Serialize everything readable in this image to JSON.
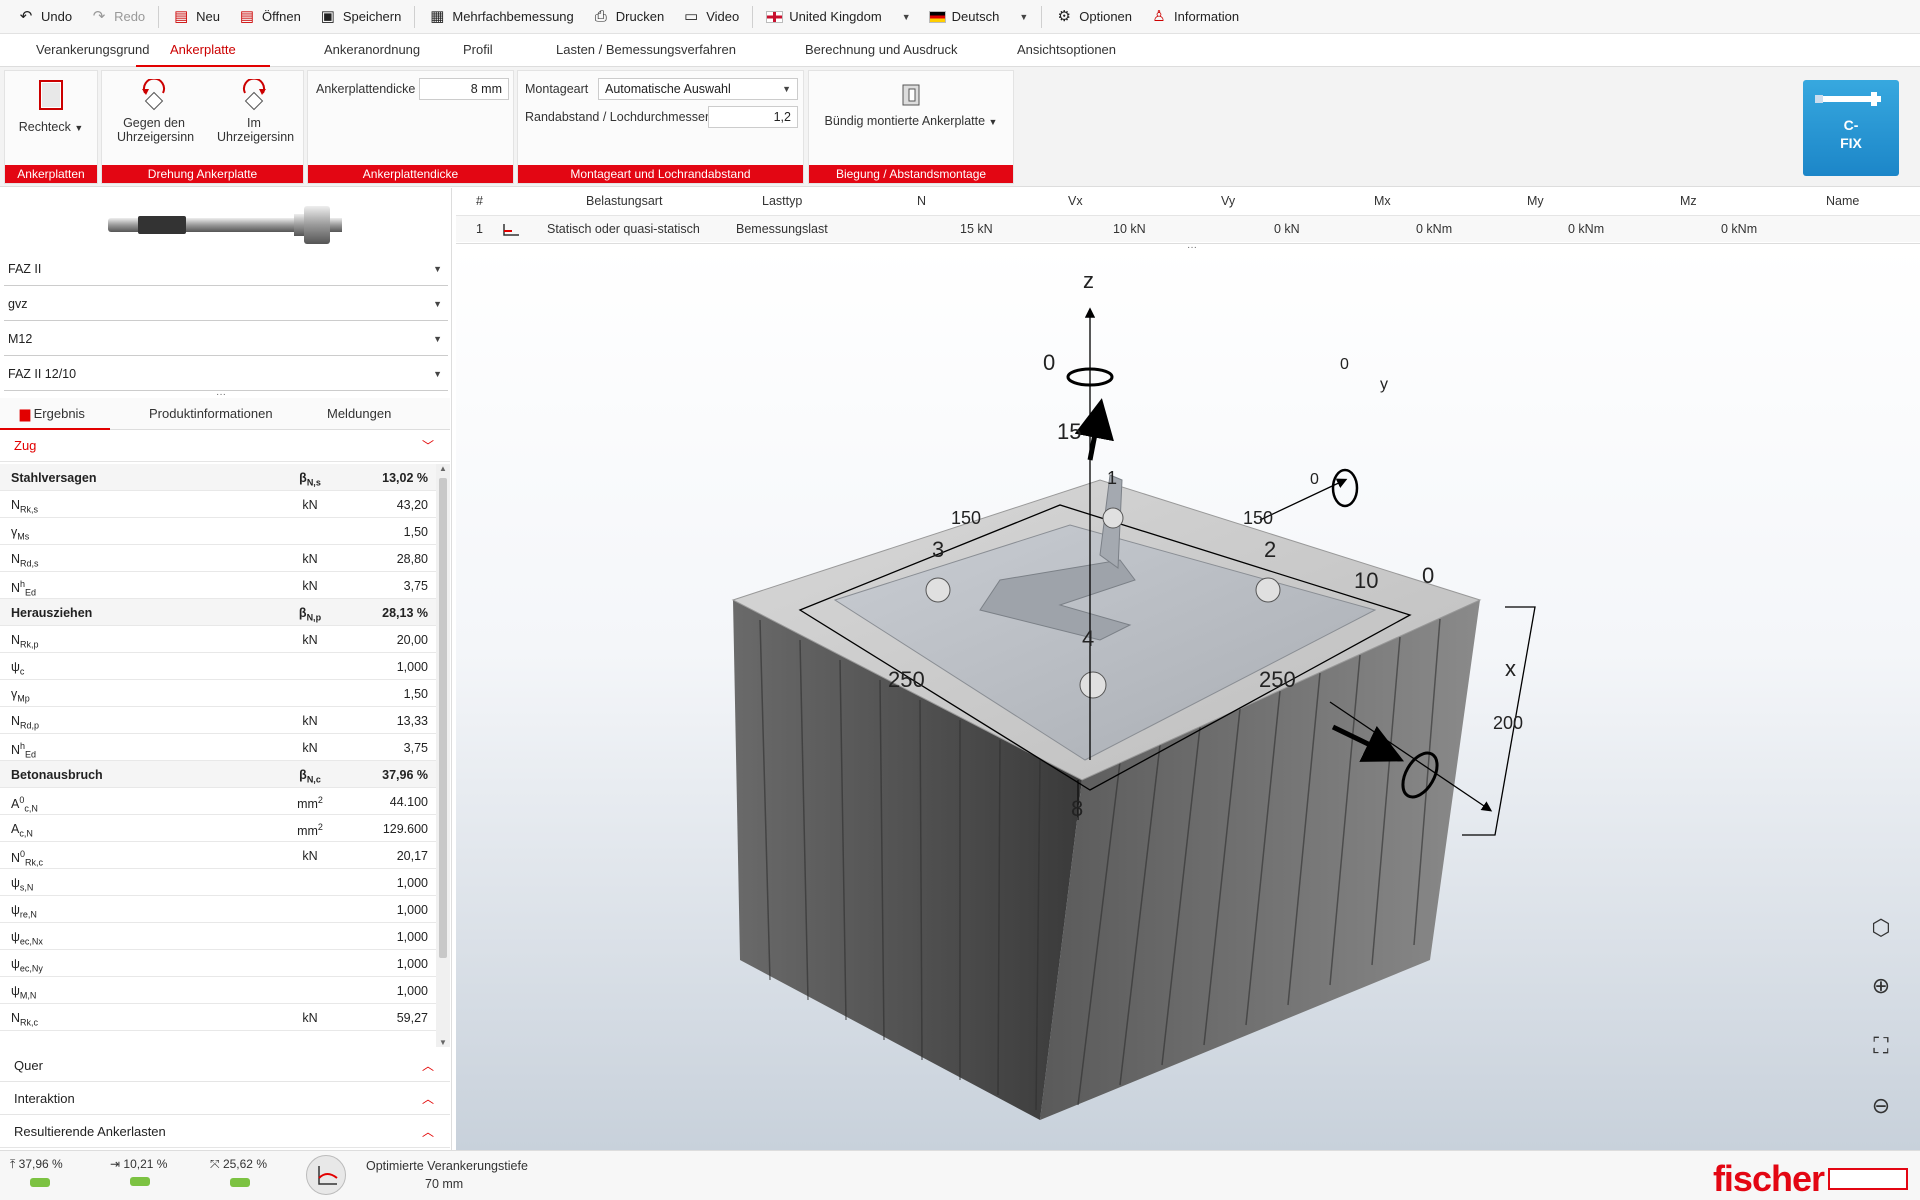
{
  "toolbar": {
    "undo": "Undo",
    "redo": "Redo",
    "new": "Neu",
    "open": "Öffnen",
    "save": "Speichern",
    "multi": "Mehrfachbemessung",
    "print": "Drucken",
    "video": "Video",
    "country": "United Kingdom",
    "language": "Deutsch",
    "options": "Optionen",
    "info": "Information"
  },
  "tabs": [
    "Verankerungsgrund",
    "Ankerplatte",
    "Ankeranordnung",
    "Profil",
    "Lasten / Bemessungsverfahren",
    "Berechnung und Ausdruck",
    "Ansichtsoptionen"
  ],
  "ribbon": {
    "shape": "Rechteck",
    "group_plates": "Ankerplatten",
    "ccw": "Gegen den Uhrzeigersinn",
    "cw": "Im Uhrzeigersinn",
    "group_rotation": "Drehung Ankerplatte",
    "thickness_label": "Ankerplattendicke",
    "thickness_value": "8 mm",
    "group_thickness": "Ankerplattendicke",
    "mount_label": "Montageart",
    "mount_value": "Automatische Auswahl",
    "edge_label": "Randabstand / Lochdurchmesser",
    "edge_value": "1,2",
    "group_mount": "Montageart und Lochrandabstand",
    "flush": "Bündig montierte Ankerplatte",
    "group_bend": "Biegung / Abstandsmontage",
    "cfix_line1": "C-",
    "cfix_line2": "FIX"
  },
  "product": {
    "selects": [
      "FAZ II",
      "gvz",
      "M12",
      "FAZ II 12/10"
    ]
  },
  "result_tabs": [
    "Ergebnis",
    "Produktinformationen",
    "Meldungen"
  ],
  "sections": {
    "zug": "Zug",
    "quer": "Quer",
    "interaktion": "Interaktion",
    "resultierende": "Resultierende Ankerlasten"
  },
  "rows": [
    {
      "k": "Stahlversagen",
      "u": "βN,s",
      "v": "13,02 %",
      "bold": true
    },
    {
      "k": "NRk,s",
      "u": "kN",
      "v": "43,20"
    },
    {
      "k": "γMs",
      "u": "",
      "v": "1,50"
    },
    {
      "k": "NRd,s",
      "u": "kN",
      "v": "28,80"
    },
    {
      "k": "NhEd",
      "u": "kN",
      "v": "3,75"
    },
    {
      "k": "Herausziehen",
      "u": "βN,p",
      "v": "28,13 %",
      "bold": true
    },
    {
      "k": "NRk,p",
      "u": "kN",
      "v": "20,00"
    },
    {
      "k": "ψc",
      "u": "",
      "v": "1,000"
    },
    {
      "k": "γMp",
      "u": "",
      "v": "1,50"
    },
    {
      "k": "NRd,p",
      "u": "kN",
      "v": "13,33"
    },
    {
      "k": "NhEd",
      "u": "kN",
      "v": "3,75"
    },
    {
      "k": "Betonausbruch",
      "u": "βN,c",
      "v": "37,96 %",
      "bold": true
    },
    {
      "k": "A0c,N",
      "u": "mm2",
      "v": "44.100"
    },
    {
      "k": "Ac,N",
      "u": "mm2",
      "v": "129.600"
    },
    {
      "k": "N0Rk,c",
      "u": "kN",
      "v": "20,17"
    },
    {
      "k": "ψs,N",
      "u": "",
      "v": "1,000"
    },
    {
      "k": "ψre,N",
      "u": "",
      "v": "1,000"
    },
    {
      "k": "ψec,Nx",
      "u": "",
      "v": "1,000"
    },
    {
      "k": "ψec,Ny",
      "u": "",
      "v": "1,000"
    },
    {
      "k": "ψM,N",
      "u": "",
      "v": "1,000"
    },
    {
      "k": "NRk,c",
      "u": "kN",
      "v": "59,27"
    }
  ],
  "loads": {
    "headers": [
      "#",
      "Belastungsart",
      "Lasttyp",
      "N",
      "Vx",
      "Vy",
      "Mx",
      "My",
      "Mz",
      "Name"
    ],
    "row": [
      "1",
      "Statisch oder quasi-statisch",
      "Bemessungslast",
      "15 kN",
      "10 kN",
      "0 kN",
      "0 kNm",
      "0 kNm",
      "0 kNm",
      ""
    ]
  },
  "model": {
    "z": "z",
    "x": "x",
    "y": "y",
    "mz": "0",
    "n": "15",
    "my": "0",
    "mx": "0",
    "vx": "10",
    "mxx": "0",
    "dim150a": "150",
    "dim150b": "150",
    "dim250a": "250",
    "dim250b": "250",
    "dim200": "200",
    "dim8": "8",
    "a1": "1",
    "a2": "2",
    "a3": "3",
    "a4": "4"
  },
  "status": {
    "s1": "37,96 %",
    "s2": "10,21 %",
    "s3": "25,62 %",
    "opt_label": "Optimierte Verankerungstiefe",
    "opt_value": "70 mm",
    "brand": "fischer"
  }
}
